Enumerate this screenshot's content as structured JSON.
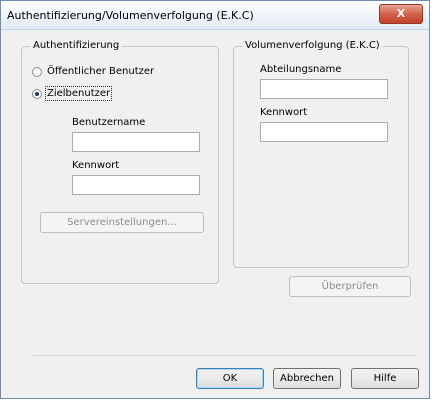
{
  "window": {
    "title": "Authentifizierung/Volumenverfolgung (E.K.C)",
    "close_label": "X"
  },
  "auth": {
    "group_title": "Authentifizierung",
    "radio_public_label": "Öffentlicher Benutzer",
    "radio_public_selected": false,
    "radio_target_label": "Zielbenutzer",
    "radio_target_selected": true,
    "username_label": "Benutzername",
    "username_value": "",
    "password_label": "Kennwort",
    "password_value": "",
    "server_settings_label": "Servereinstellungen..."
  },
  "volume": {
    "group_title": "Volumenverfolgung (E.K.C)",
    "department_label": "Abteilungsname",
    "department_value": "",
    "password_label": "Kennwort",
    "password_value": "",
    "verify_label": "Überprüfen"
  },
  "footer": {
    "ok_label": "OK",
    "cancel_label": "Abbrechen",
    "help_label": "Hilfe"
  }
}
